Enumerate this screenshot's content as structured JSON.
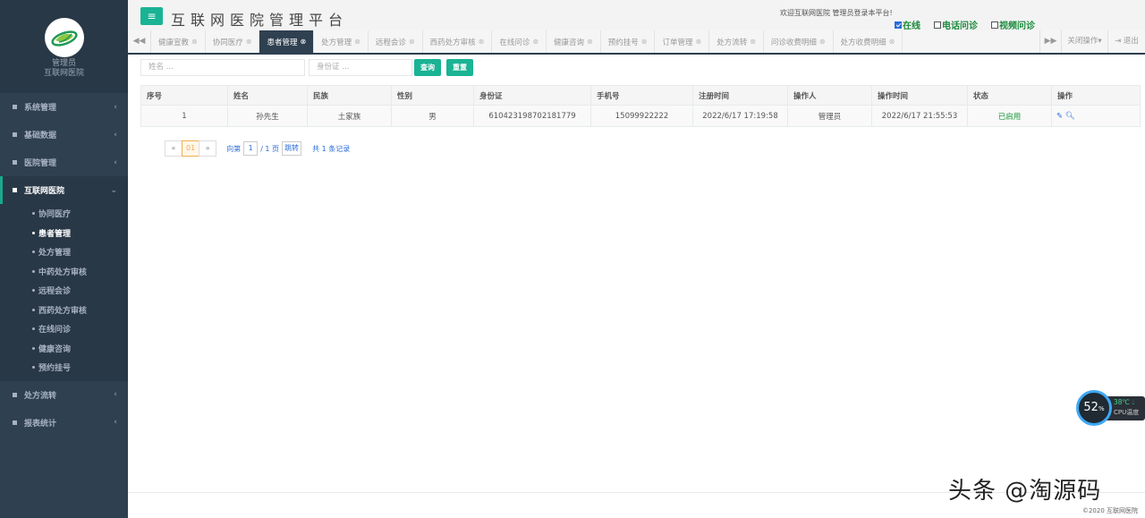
{
  "sidebar": {
    "role": "管理员",
    "org": "互联网医院",
    "menu": [
      {
        "label": "系统管理",
        "arrow": "‹"
      },
      {
        "label": "基础数据",
        "arrow": "‹"
      },
      {
        "label": "医院管理",
        "arrow": "‹"
      },
      {
        "label": "互联网医院",
        "arrow": "⌄"
      },
      {
        "label": "处方流转",
        "arrow": "‹"
      },
      {
        "label": "报表统计",
        "arrow": "‹"
      }
    ],
    "submenu": [
      "协同医疗",
      "患者管理",
      "处方管理",
      "中药处方审核",
      "远程会诊",
      "西药处方审核",
      "在线问诊",
      "健康咨询",
      "预约挂号"
    ]
  },
  "header": {
    "title": "互联网医院管理平台",
    "welcome": "欢迎互联网医院 管理员登录本平台!",
    "status": [
      "在线",
      "电话问诊",
      "视频问诊"
    ]
  },
  "tabs": {
    "items": [
      "健康宣教",
      "协同医疗",
      "患者管理",
      "处方管理",
      "远程会诊",
      "西药处方审核",
      "在线问诊",
      "健康咨询",
      "预约挂号",
      "订单管理",
      "处方流转",
      "问诊收费明细",
      "处方收费明细"
    ],
    "close_ops": "关闭操作",
    "logout": "退出"
  },
  "search": {
    "name_placeholder": "姓名 ...",
    "id_placeholder": "身份证 ...",
    "query_label": "查询",
    "reset_label": "重置"
  },
  "table": {
    "headers": [
      "序号",
      "姓名",
      "民族",
      "性别",
      "身份证",
      "手机号",
      "注册时间",
      "操作人",
      "操作时间",
      "状态",
      "操作"
    ],
    "rows": [
      [
        "1",
        "孙先生",
        "土家族",
        "男",
        "610423198702181779",
        "15099922222",
        "2022/6/17 17:19:58",
        "管理员",
        "2022/6/17 21:55:53",
        "已启用"
      ]
    ]
  },
  "pager": {
    "prev": "«",
    "current": "01",
    "next": "»",
    "goto_prefix": "向第",
    "goto_value": "1",
    "total_pages": "/ 1 页",
    "jump": "跳转",
    "total_records": "共 1 条记录"
  },
  "cpu": {
    "percent": "52",
    "percent_unit": "%",
    "temp": "38℃",
    "label": "CPU温度"
  },
  "footer": {
    "copyright": "©2020 互联网医院",
    "watermark": "头条 @淘源码"
  },
  "colors": {
    "accent": "#1ab394",
    "sidebar": "#2f4050",
    "link": "#2b6cd8"
  }
}
